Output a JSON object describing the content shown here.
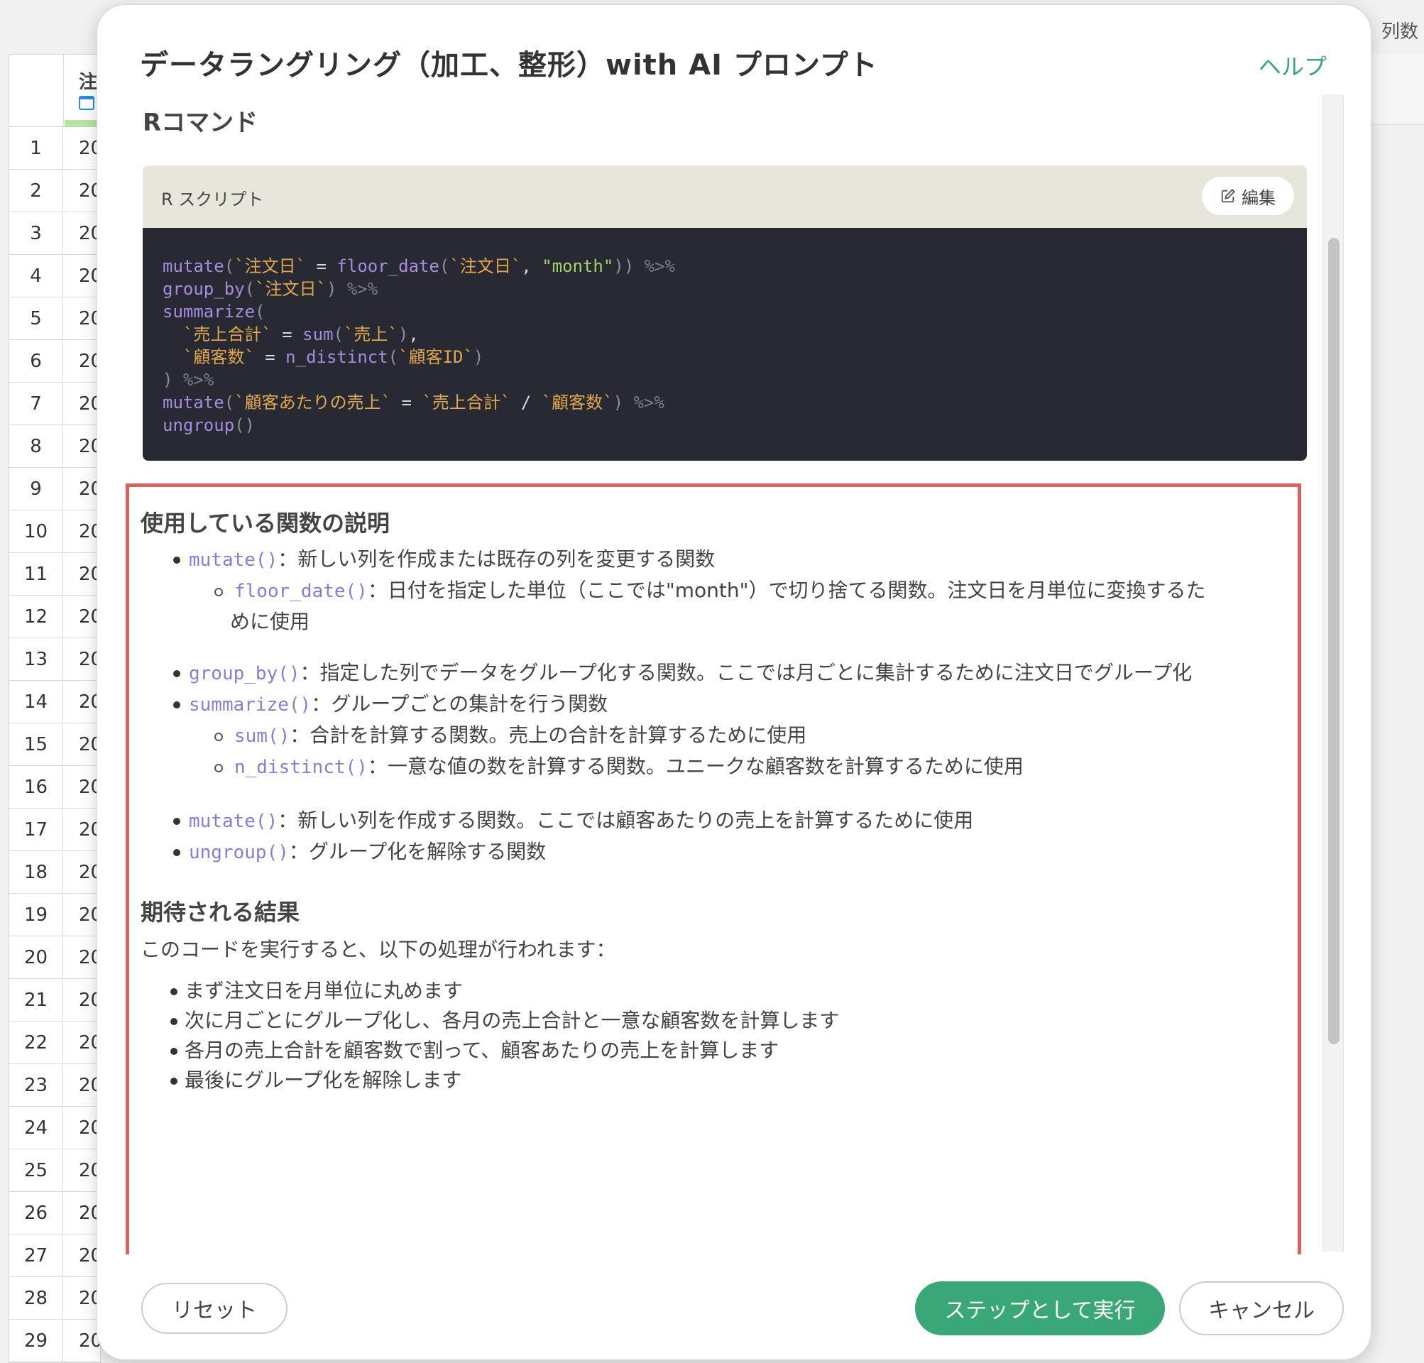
{
  "background": {
    "column_name": "注",
    "right_label": "列数",
    "rows": [
      {
        "n": "1",
        "v": "20"
      },
      {
        "n": "2",
        "v": "20"
      },
      {
        "n": "3",
        "v": "20"
      },
      {
        "n": "4",
        "v": "20"
      },
      {
        "n": "5",
        "v": "20"
      },
      {
        "n": "6",
        "v": "20"
      },
      {
        "n": "7",
        "v": "20"
      },
      {
        "n": "8",
        "v": "20"
      },
      {
        "n": "9",
        "v": "20"
      },
      {
        "n": "10",
        "v": "20"
      },
      {
        "n": "11",
        "v": "20"
      },
      {
        "n": "12",
        "v": "20"
      },
      {
        "n": "13",
        "v": "20"
      },
      {
        "n": "14",
        "v": "20"
      },
      {
        "n": "15",
        "v": "20"
      },
      {
        "n": "16",
        "v": "20"
      },
      {
        "n": "17",
        "v": "20"
      },
      {
        "n": "18",
        "v": "20"
      },
      {
        "n": "19",
        "v": "20"
      },
      {
        "n": "20",
        "v": "20"
      },
      {
        "n": "21",
        "v": "20"
      },
      {
        "n": "22",
        "v": "20"
      },
      {
        "n": "23",
        "v": "20"
      },
      {
        "n": "24",
        "v": "20"
      },
      {
        "n": "25",
        "v": "20"
      },
      {
        "n": "26",
        "v": "20"
      },
      {
        "n": "27",
        "v": "20"
      },
      {
        "n": "28",
        "v": "20"
      },
      {
        "n": "29",
        "v": "20"
      }
    ]
  },
  "modal": {
    "title": "データラングリング（加工、整形）with AI プロンプト",
    "help": "ヘルプ",
    "r_command_heading": "Rコマンド",
    "script_label": "R スクリプト",
    "edit_label": "編集",
    "code_lines": [
      "mutate(`注文日` = floor_date(`注文日`, \"month\")) %>%",
      "group_by(`注文日`) %>%",
      "summarize(",
      "  `売上合計` = sum(`売上`),",
      "  `顧客数` = n_distinct(`顧客ID`)",
      ") %>%",
      "mutate(`顧客あたりの売上` = `売上合計` / `顧客数`) %>%",
      "ungroup()"
    ],
    "functions_heading": "使用している関数の説明",
    "functions": [
      {
        "code": "mutate()",
        "text": "：新しい列を作成または既存の列を変更する関数"
      },
      {
        "code": "floor_date()",
        "text": "：日付を指定した単位（ここでは\"month\"）で切り捨てる関数。注文日を月単位に変換するた",
        "cont": "めに使用"
      },
      {
        "code": "group_by()",
        "text": "：指定した列でデータをグループ化する関数。ここでは月ごとに集計するために注文日でグループ化"
      },
      {
        "code": "summarize()",
        "text": "：グループごとの集計を行う関数"
      },
      {
        "code": "sum()",
        "text": "：合計を計算する関数。売上の合計を計算するために使用"
      },
      {
        "code": "n_distinct()",
        "text": "：一意な値の数を計算する関数。ユニークな顧客数を計算するために使用"
      },
      {
        "code": "mutate()",
        "text": "：新しい列を作成する関数。ここでは顧客あたりの売上を計算するために使用"
      },
      {
        "code": "ungroup()",
        "text": "：グループ化を解除する関数"
      }
    ],
    "result_heading": "期待される結果",
    "result_intro": "このコードを実行すると、以下の処理が行われます：",
    "results": [
      "まず注文日を月単位に丸めます",
      "次に月ごとにグループ化し、各月の売上合計と一意な顧客数を計算します",
      "各月の売上合計を顧客数で割って、顧客あたりの売上を計算します",
      "最後にグループ化を解除します"
    ],
    "reset_label": "リセット",
    "run_label": "ステップとして実行",
    "cancel_label": "キャンセル"
  },
  "colors": {
    "accent_green": "#3aa776",
    "highlight_border": "#d9625e",
    "code_bg": "#272a33",
    "code_function": "#a98bdf",
    "code_backtick": "#e2a64f",
    "code_string": "#a3d36e"
  },
  "icons": {
    "edit": "pencil-square-icon",
    "calendar": "calendar-icon"
  }
}
